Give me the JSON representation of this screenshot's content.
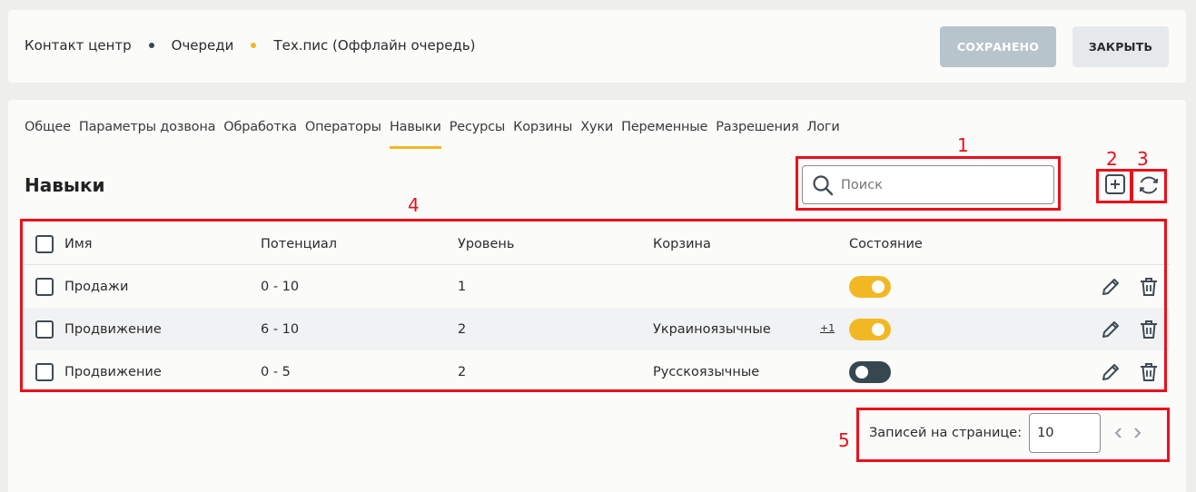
{
  "breadcrumb": {
    "items": [
      "Контакт центр",
      "Очереди",
      "Тех.пис (Оффлайн очередь)"
    ],
    "dot_colors": [
      "#37474f",
      "#f2b824"
    ]
  },
  "header_actions": {
    "saved_label": "СОХРАНЕНО",
    "close_label": "ЗАКРЫТЬ"
  },
  "tabs": [
    {
      "label": "Общее"
    },
    {
      "label": "Параметры дозвона"
    },
    {
      "label": "Обработка"
    },
    {
      "label": "Операторы"
    },
    {
      "label": "Навыки",
      "active": true
    },
    {
      "label": "Ресурсы"
    },
    {
      "label": "Корзины"
    },
    {
      "label": "Хуки"
    },
    {
      "label": "Переменные"
    },
    {
      "label": "Разрешения"
    },
    {
      "label": "Логи"
    }
  ],
  "section": {
    "title": "Навыки"
  },
  "search": {
    "placeholder": "Поиск",
    "icon": "search-icon"
  },
  "toolbar": {
    "add_icon": "add-square-icon",
    "refresh_icon": "refresh-icon"
  },
  "table": {
    "columns": [
      "Имя",
      "Потенциал",
      "Уровень",
      "Корзина",
      "Состояние"
    ],
    "rows": [
      {
        "name": "Продажи",
        "potential": "0 - 10",
        "level": "1",
        "basket": "",
        "more": "",
        "enabled": true
      },
      {
        "name": "Продвижение",
        "potential": "6 - 10",
        "level": "2",
        "basket": "Украиноязычные",
        "more": "+1",
        "enabled": true
      },
      {
        "name": "Продвижение",
        "potential": "0 - 5",
        "level": "2",
        "basket": "Русскоязычные",
        "more": "",
        "enabled": false
      }
    ]
  },
  "pagination": {
    "label": "Записей на странице:",
    "per_page": "10"
  },
  "annotations": {
    "labels": [
      "1",
      "2",
      "3",
      "4",
      "5"
    ],
    "color": "#e8111b"
  },
  "colors": {
    "accent": "#f2b824",
    "toggle_off": "#37474f",
    "saved_button": "#b8c4cb"
  }
}
